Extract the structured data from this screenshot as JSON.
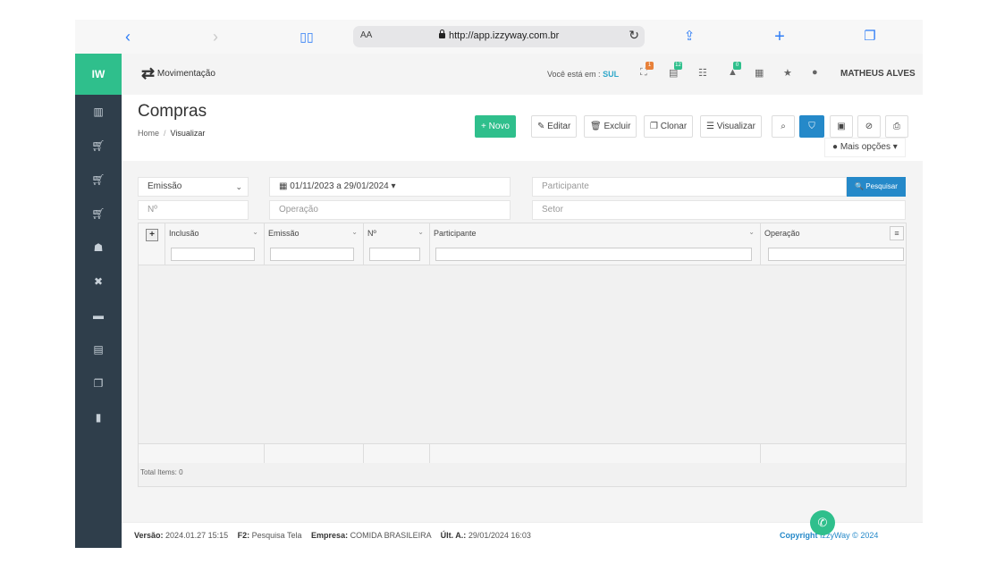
{
  "browser": {
    "url_prefix": "AA",
    "url": "http://app.izzyway.com.br",
    "icons": [
      "back-icon",
      "forward-icon",
      "book-icon",
      "share-icon",
      "plus-icon",
      "tabs-icon"
    ]
  },
  "sidebar": {
    "logo": "IW",
    "items": [
      "chart-icon",
      "cart-icon",
      "cart-icon",
      "cart-icon",
      "users-icon",
      "tools-icon",
      "card-icon",
      "list-icon",
      "copy-icon",
      "document-icon"
    ]
  },
  "topbar": {
    "section": "Movimentação",
    "location_label": "Você está em :",
    "location_value": "SUL",
    "badges": [
      {
        "icon": "sitemap-icon",
        "count": "1",
        "color": "#e8813a"
      },
      {
        "icon": "book-icon",
        "count": "12",
        "color": "#2fbf8c"
      },
      {
        "icon": "list-icon",
        "count": "",
        "color": ""
      },
      {
        "icon": "bell-icon",
        "count": "0",
        "color": "#2fbf8c"
      },
      {
        "icon": "calendar-icon",
        "count": "",
        "color": ""
      },
      {
        "icon": "star-icon",
        "count": "",
        "color": ""
      },
      {
        "icon": "help-icon",
        "count": "",
        "color": ""
      }
    ],
    "user": "MATHEUS ALVES"
  },
  "page": {
    "title": "Compras",
    "breadcrumb_home": "Home",
    "breadcrumb_current": "Visualizar"
  },
  "toolbar": {
    "novo": "+ Novo",
    "editar": "✎ Editar",
    "excluir": "🗑 Excluir",
    "clonar": "❐ Clonar",
    "visualizar": "☰ Visualizar",
    "mais_opcoes": "● Mais opções ▾"
  },
  "filters": {
    "date_type": "Emissão",
    "date_range": "▦ 01/11/2023 a 29/01/2024 ▾",
    "participante_placeholder": "Participante",
    "pesquisar": "🔍 Pesquisar",
    "numero_placeholder": "Nº",
    "operacao_placeholder": "Operação",
    "setor_placeholder": "Setor"
  },
  "grid": {
    "columns": [
      "Inclusão",
      "Emissão",
      "Nº",
      "Participante",
      "Operação"
    ],
    "total_label": "Total Items: 0"
  },
  "footer": {
    "versao_label": "Versão:",
    "versao_value": "2024.01.27 15:15",
    "f2_label": "F2:",
    "f2_value": "Pesquisa Tela",
    "empresa_label": "Empresa:",
    "empresa_value": "COMIDA BRASILEIRA",
    "ult_label": "Últ. A.:",
    "ult_value": "29/01/2024 16:03",
    "copyright_label": "Copyright",
    "copyright_value": "IzzyWay © 2024"
  },
  "colors": {
    "accent_green": "#2fbf8c",
    "accent_blue": "#2589c9",
    "sidebar": "#2f3e4b"
  }
}
